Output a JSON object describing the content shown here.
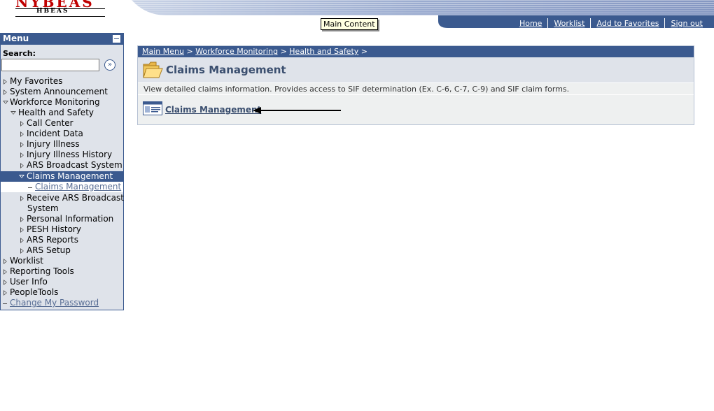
{
  "header": {
    "logo_main": "NYBEAS",
    "logo_sub": "HBEAS",
    "nav": [
      {
        "label": "Home"
      },
      {
        "label": "Worklist"
      },
      {
        "label": "Add to Favorites"
      },
      {
        "label": "Sign out"
      }
    ],
    "tooltip": "Main Content"
  },
  "menu": {
    "title": "Menu",
    "search_label": "Search:",
    "search_value": "",
    "items": [
      {
        "label": "My Favorites"
      },
      {
        "label": "System Announcement"
      },
      {
        "label": "Workforce Monitoring"
      },
      {
        "label": "Health and Safety"
      },
      {
        "label": "Call Center"
      },
      {
        "label": "Incident Data"
      },
      {
        "label": "Injury Illness"
      },
      {
        "label": "Injury Illness History"
      },
      {
        "label": "ARS Broadcast System"
      },
      {
        "label": "Claims Management"
      },
      {
        "label": "Claims Management"
      },
      {
        "label": "Receive ARS Broadcast"
      },
      {
        "label": "System"
      },
      {
        "label": "Personal Information"
      },
      {
        "label": "PESH History"
      },
      {
        "label": "ARS Reports"
      },
      {
        "label": "ARS Setup"
      },
      {
        "label": "Worklist"
      },
      {
        "label": "Reporting Tools"
      },
      {
        "label": "User Info"
      },
      {
        "label": "PeopleTools"
      },
      {
        "label": "Change My Password"
      }
    ]
  },
  "main": {
    "breadcrumb": [
      {
        "label": "Main Menu"
      },
      {
        "label": "Workforce Monitoring"
      },
      {
        "label": "Health and Safety"
      }
    ],
    "crumb_sep": ">",
    "title": "Claims Management",
    "description": "View detailed claims information. Provides access to SIF determination (Ex. C-6, C-7, C-9) and SIF claim forms.",
    "link_label": "Claims Management"
  },
  "colors": {
    "brand_blue": "#3b5a8f",
    "menu_bg": "#dfe3ea",
    "logo_red": "#c00000"
  }
}
